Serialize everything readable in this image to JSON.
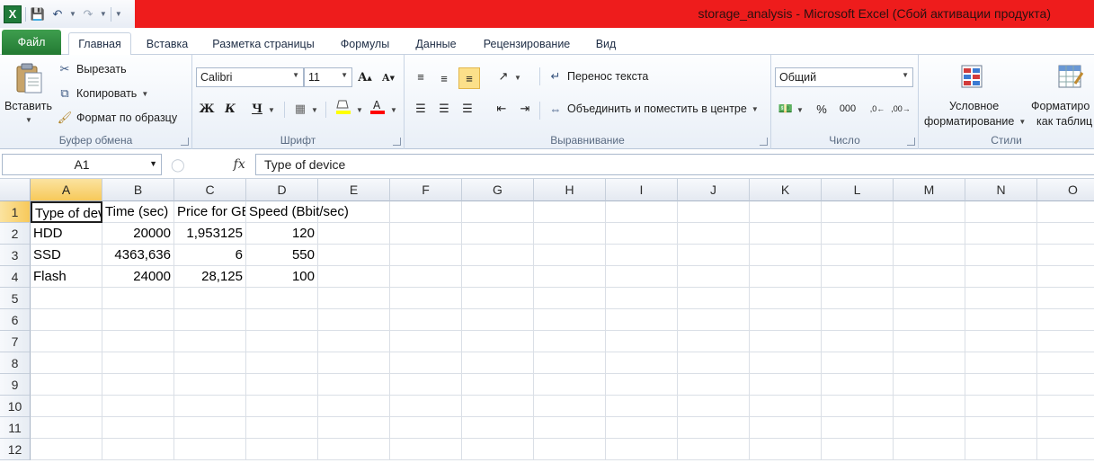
{
  "window": {
    "title": "storage_analysis  -  Microsoft Excel (Сбой активации продукта)"
  },
  "quick_access": {
    "app_icon": "X"
  },
  "ribbon_tabs": [
    {
      "label": "Файл"
    },
    {
      "label": "Главная"
    },
    {
      "label": "Вставка"
    },
    {
      "label": "Разметка страницы"
    },
    {
      "label": "Формулы"
    },
    {
      "label": "Данные"
    },
    {
      "label": "Рецензирование"
    },
    {
      "label": "Вид"
    }
  ],
  "clipboard": {
    "paste": "Вставить",
    "cut": "Вырезать",
    "copy": "Копировать",
    "format_painter": "Формат по образцу",
    "label": "Буфер обмена"
  },
  "font": {
    "name": "Calibri",
    "size": "11",
    "bold": "Ж",
    "italic": "К",
    "underline": "Ч",
    "label": "Шрифт"
  },
  "alignment": {
    "wrap_text": "Перенос текста",
    "merge_center": "Объединить и поместить в центре",
    "label": "Выравнивание"
  },
  "number": {
    "format": "Общий",
    "percent": "%",
    "thousands": "000",
    "label": "Число"
  },
  "styles": {
    "conditional_line1": "Условное",
    "conditional_line2": "форматирование",
    "format_table_line1": "Форматиро",
    "format_table_line2": "как таблиц",
    "label": "Стили"
  },
  "formula_bar": {
    "name_box": "A1",
    "fx": "fx",
    "content": "Type of device"
  },
  "columns": [
    "A",
    "B",
    "C",
    "D",
    "E",
    "F",
    "G",
    "H",
    "I",
    "J",
    "K",
    "L",
    "M",
    "N",
    "O"
  ],
  "rows": [
    "1",
    "2",
    "3",
    "4",
    "5",
    "6",
    "7",
    "8",
    "9",
    "10",
    "11",
    "12"
  ],
  "cells": {
    "A1": "Type of device",
    "B1": "Time (sec)",
    "C1": "Price for GB",
    "D1": "Speed (Bbit/sec)",
    "A2": "HDD",
    "B2": "20000",
    "C2": "1,953125",
    "D2": "120",
    "A3": "SSD",
    "B3": "4363,636",
    "C3": "6",
    "D3": "550",
    "A4": "Flash",
    "B4": "24000",
    "C4": "28,125",
    "D4": "100"
  }
}
